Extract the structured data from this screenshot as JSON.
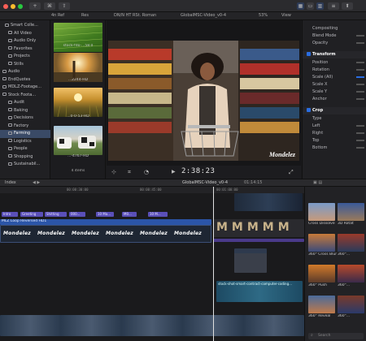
{
  "toolbar": {
    "undo": "←",
    "redo": "→"
  },
  "header": {
    "tab": "4n Ref",
    "info": "Res",
    "library": "Library",
    "project": "DN/N HT RSt. Roman",
    "clip_title": "GlobalMSC-Video_v0-4",
    "zoom": "53%",
    "view": "View"
  },
  "sidebar": {
    "items": [
      {
        "label": "Smart Colle..."
      },
      {
        "label": "All Video"
      },
      {
        "label": "Audio Only"
      },
      {
        "label": "Favorites"
      },
      {
        "label": "Projects"
      },
      {
        "label": "Stills"
      },
      {
        "label": "Audio"
      },
      {
        "label": "EndQuotes"
      },
      {
        "label": "MDLZ-Footage..."
      },
      {
        "label": "Stock Foota..."
      },
      {
        "label": "Audit"
      },
      {
        "label": "Baking"
      },
      {
        "label": "Decisions"
      },
      {
        "label": "Factory"
      },
      {
        "label": "Farming"
      },
      {
        "label": "Logistics"
      },
      {
        "label": "People"
      },
      {
        "label": "Shopping"
      },
      {
        "label": "Sustainabil..."
      }
    ]
  },
  "browser": {
    "clips": [
      {
        "caption": "stock-fdo-...58.0"
      },
      {
        "caption": "...2244-HD"
      },
      {
        "caption": "...0-0-53-HD"
      },
      {
        "caption": "...-4767-HD"
      }
    ],
    "count": "4 items"
  },
  "viewer": {
    "timecode": "2:38:23",
    "watermark": "Mondelez"
  },
  "inspector": {
    "rows": [
      {
        "label": "Compositing"
      },
      {
        "label": "Blend Mode"
      },
      {
        "label": "Opacity"
      },
      {
        "label": "Transform",
        "section": true
      },
      {
        "label": "Position"
      },
      {
        "label": "Rotation"
      },
      {
        "label": "Scale (All)"
      },
      {
        "label": "Scale X"
      },
      {
        "label": "Scale Y"
      },
      {
        "label": "Anchor"
      },
      {
        "label": "Crop",
        "section": true
      },
      {
        "label": "Type"
      },
      {
        "label": "Left"
      },
      {
        "label": "Right"
      },
      {
        "label": "Top"
      },
      {
        "label": "Bottom"
      }
    ]
  },
  "timeline": {
    "index": "Index",
    "project": "GlobalMSC-Video_v0-4",
    "duration": "01:14:15",
    "ruler": [
      "00:00:30:00",
      "00:00:45:00",
      "00:01:00:00"
    ],
    "tags": [
      "Intro",
      "Greeting",
      "Shitting",
      "000...",
      "10 Ma...",
      "M0...",
      "10 M..."
    ],
    "title_clip": "MLZ Loop Reversed HD1",
    "lower_clip": "stock_shot-...",
    "spoke_clip": "stock-shot-smart-contract-computer-coding..."
  },
  "effects": {
    "items": [
      {
        "label": "Cross Dissolve"
      },
      {
        "label": "3D Rotat"
      },
      {
        "label": "360° Cross Blur"
      },
      {
        "label": "360°..."
      },
      {
        "label": "360° Push"
      },
      {
        "label": "360°..."
      },
      {
        "label": "360° Reveal"
      },
      {
        "label": "360°..."
      }
    ],
    "search": "Search"
  },
  "colors": {
    "accent": "#2a6de0",
    "tag": "#5a4fb8",
    "title_clip": "#2b55a8",
    "connected_clip": "#2e5f7a"
  }
}
